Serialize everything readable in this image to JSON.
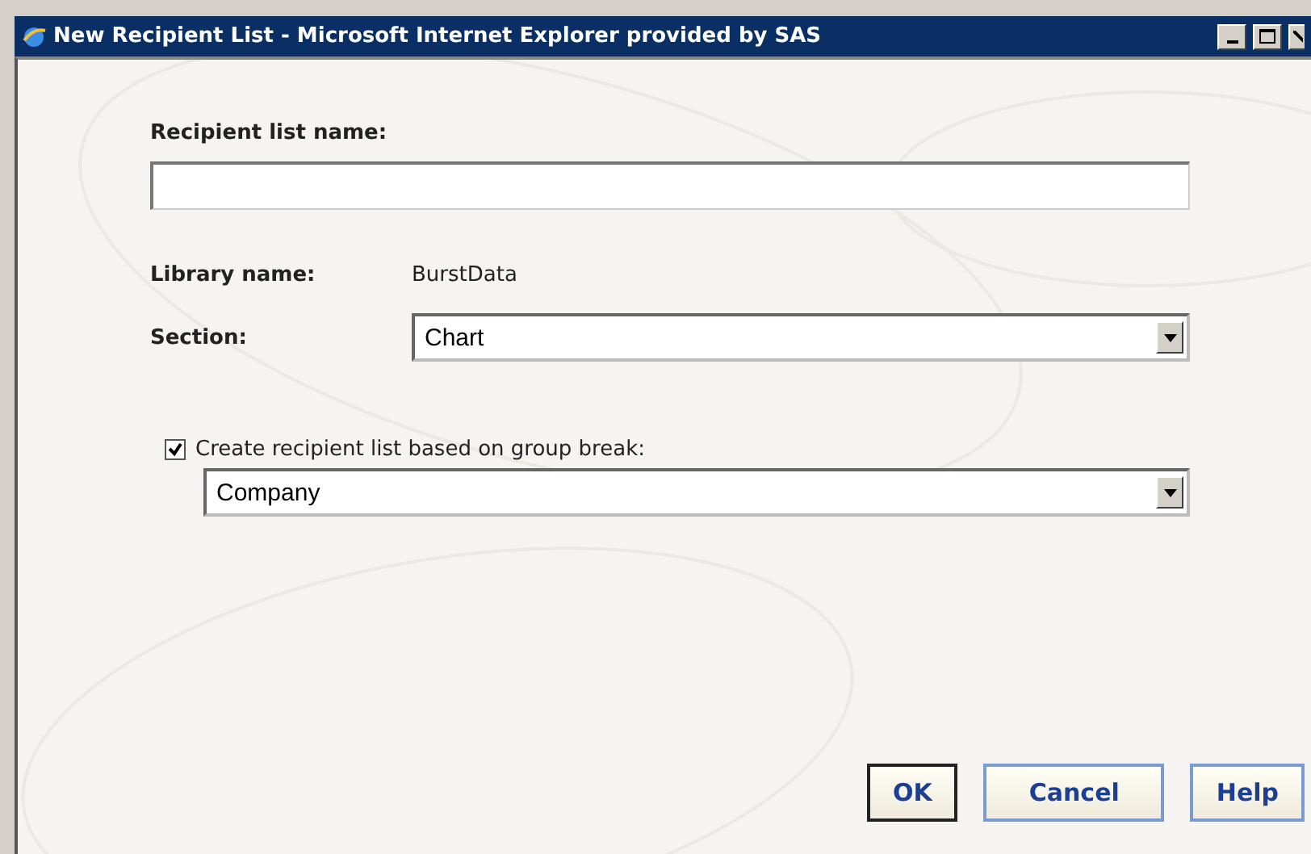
{
  "window": {
    "title": "New Recipient List - Microsoft Internet Explorer provided by SAS"
  },
  "form": {
    "name_label": "Recipient list name:",
    "library_label": "Library name:",
    "library_value": "BurstData",
    "section_label": "Section:",
    "section_value": "Chart",
    "group_break": {
      "label": "Create recipient list based on group break:",
      "checked": true,
      "value": "Company"
    }
  },
  "buttons": [
    {
      "label": "OK",
      "default": true
    },
    {
      "label": "Cancel",
      "default": false
    },
    {
      "label": "Help",
      "default": false
    }
  ]
}
